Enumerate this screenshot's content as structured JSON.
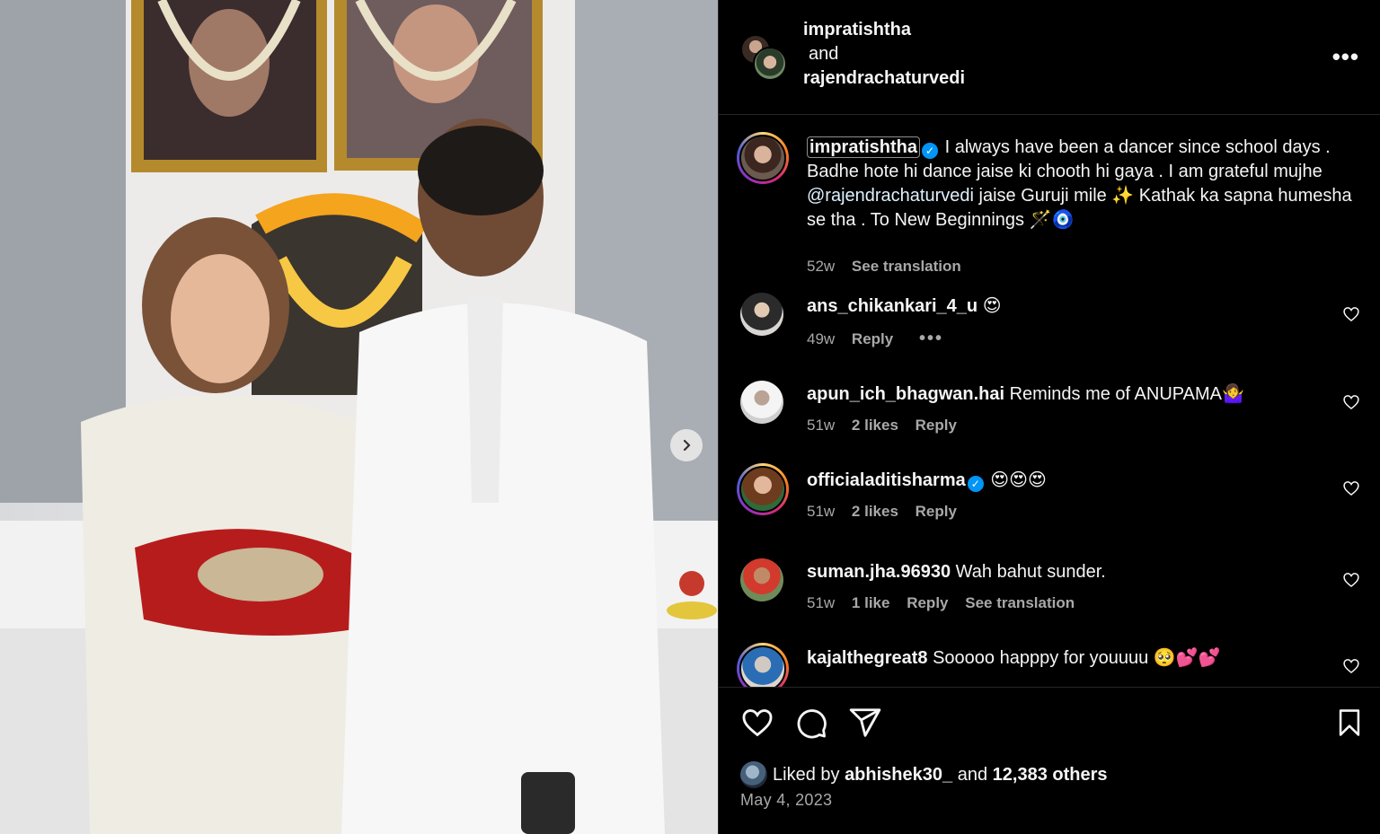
{
  "post": {
    "header": {
      "user1": "impratishtha",
      "and": "and",
      "user2": "rajendrachaturvedi"
    },
    "caption": {
      "user": "impratishtha",
      "text_1": " I always have been a dancer since school days . Badhe hote hi dance jaise ki chooth hi gaya . I am grateful mujhe ",
      "mention": "@rajendrachaturvedi",
      "text_2": " jaise Guruji mile ✨ Kathak ka sapna humesha se tha . To New Beginnings 🪄🧿",
      "age": "52w",
      "see_translation": "See translation"
    },
    "comments": [
      {
        "user": "ans_chikankari_4_u",
        "text": "😍",
        "age": "49w",
        "likes": "",
        "reply": "Reply",
        "extra": "•••"
      },
      {
        "user": "apun_ich_bhagwan.hai",
        "text": "Reminds me of ANUPAMA🤷‍♀️",
        "age": "51w",
        "likes": "2 likes",
        "reply": "Reply",
        "extra": ""
      },
      {
        "user": "officialaditisharma",
        "text": "😍😍😍",
        "age": "51w",
        "likes": "2 likes",
        "reply": "Reply",
        "extra": ""
      },
      {
        "user": "suman.jha.96930",
        "text": "Wah bahut sunder.",
        "age": "51w",
        "likes": "1 like",
        "reply": "Reply",
        "extra": "See translation"
      },
      {
        "user": "kajalthegreat8",
        "text": "Sooooo happpy for youuuu 🥺💕💕",
        "age": "",
        "likes": "",
        "reply": "",
        "extra": ""
      }
    ],
    "footer": {
      "liked_by": "Liked by",
      "liker": "abhishek30_",
      "and": "and",
      "others": "12,383 others",
      "date": "May 4, 2023"
    },
    "icons": {
      "more": "more-options-icon",
      "next": "chevron-right-icon",
      "like": "heart-icon",
      "comment": "comment-icon",
      "share": "share-icon",
      "save": "bookmark-icon"
    },
    "colors": {
      "background": "#000000",
      "text": "#f5f5f5",
      "secondary": "#a8a8a8",
      "verified": "#0095f6"
    }
  }
}
